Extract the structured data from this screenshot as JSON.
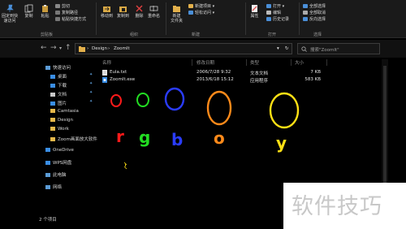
{
  "ribbon": {
    "clipboard": {
      "pin_label": "固定到快\n速访问",
      "copy_label": "复制",
      "paste_label": "粘贴",
      "cut_label": "剪切",
      "copy_path_label": "复制路径",
      "paste_shortcut_label": "粘贴快捷方式",
      "group_label": "剪贴板"
    },
    "organize": {
      "move_to_label": "移动到",
      "copy_to_label": "复制到",
      "delete_label": "删除",
      "rename_label": "重命名",
      "group_label": "组织"
    },
    "new": {
      "new_folder_label": "新建\n文件夹",
      "new_item_label": "新建项目",
      "easy_access_label": "轻松访问",
      "group_label": "新建"
    },
    "open": {
      "properties_label": "属性",
      "open_label": "打开",
      "edit_label": "编辑",
      "history_label": "历史记录",
      "group_label": "打开"
    },
    "select": {
      "select_all_label": "全部选择",
      "select_none_label": "全部取消",
      "invert_label": "反向选择",
      "group_label": "选择"
    }
  },
  "address": {
    "path": [
      "Design",
      "ZoomIt"
    ],
    "search_placeholder": "搜索\"ZoomIt\""
  },
  "sidebar": {
    "items": [
      {
        "label": "快速访问",
        "color": "#5b9bd5"
      },
      {
        "label": "桌面",
        "color": "#3a8ee6"
      },
      {
        "label": "下载",
        "color": "#3a8ee6"
      },
      {
        "label": "文档",
        "color": "#c9c9c9"
      },
      {
        "label": "图片",
        "color": "#3a8ee6"
      },
      {
        "label": "Camtasia",
        "color": "#e6b84a"
      },
      {
        "label": "Design",
        "color": "#e6b84a"
      },
      {
        "label": "Work",
        "color": "#e6b84a"
      },
      {
        "label": "Zoom画面放大软件",
        "color": "#e6b84a"
      },
      {
        "label": "OneDrive",
        "color": "#3a8ee6"
      },
      {
        "label": "WPS网盘",
        "color": "#3a8ee6"
      },
      {
        "label": "此电脑",
        "color": "#5b9bd5"
      },
      {
        "label": "网络",
        "color": "#5b9bd5"
      }
    ]
  },
  "columns": {
    "name": "名称",
    "date": "修改日期",
    "type": "类型",
    "size": "大小"
  },
  "files": [
    {
      "name": "Eula.txt",
      "date": "2006/7/28 9:32",
      "type": "文本文档",
      "size": "7 KB"
    },
    {
      "name": "ZoomIt.exe",
      "date": "2013/6/18 15:12",
      "type": "应用程序",
      "size": "583 KB"
    }
  ],
  "annotations": {
    "letters": [
      "r",
      "g",
      "b",
      "o",
      "y"
    ],
    "colors": [
      "#ff1a1a",
      "#22dd22",
      "#2a3cff",
      "#ff8a1a",
      "#ffe014"
    ]
  },
  "status": {
    "count": "2 个项目"
  },
  "watermark": {
    "text": "软件技巧"
  }
}
